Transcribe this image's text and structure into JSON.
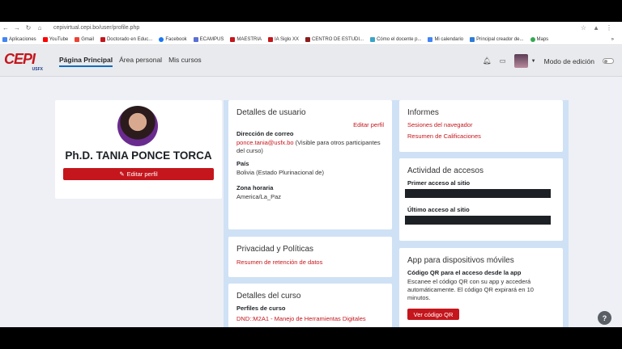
{
  "browser": {
    "url": "cepivirtual.cepi.bo/user/profile.php",
    "bookmarks": [
      {
        "label": "Aplicaciones",
        "color": "#4285f4"
      },
      {
        "label": "YouTube",
        "color": "#ff0000"
      },
      {
        "label": "Gmail",
        "color": "#ea4335"
      },
      {
        "label": "Doctorado en Educ...",
        "color": "#c4161c"
      },
      {
        "label": "Facebook",
        "color": "#1877f2"
      },
      {
        "label": "ECAMPUS",
        "color": "#5b6fd6"
      },
      {
        "label": "MAESTRIA",
        "color": "#c4161c"
      },
      {
        "label": "IA Siglo XX",
        "color": "#c4161c"
      },
      {
        "label": "CENTRO DE ESTUDI...",
        "color": "#8b1c1c"
      },
      {
        "label": "Cómo el docente p...",
        "color": "#3aa3c8"
      },
      {
        "label": "Mi calendario",
        "color": "#4285f4"
      },
      {
        "label": "Principal creador de...",
        "color": "#2d7bd6"
      },
      {
        "label": "Maps",
        "color": "#34a853"
      }
    ],
    "more": "»"
  },
  "header": {
    "logo": "CEPI",
    "logo_sub": "USFX",
    "nav": [
      "Página Principal",
      "Área personal",
      "Mis cursos"
    ],
    "edit_mode": "Modo de edición"
  },
  "profile": {
    "name": "Ph.D. TANIA PONCE TORCA",
    "edit_button": "Editar perfil"
  },
  "user_details": {
    "title": "Detalles de usuario",
    "edit_link": "Editar perfil",
    "email_label": "Dirección de correo",
    "email": "ponce.tania@usfx.bo",
    "email_note": "(Visible para otros participantes del curso)",
    "country_label": "País",
    "country": "Bolivia (Estado Plurinacional de)",
    "timezone_label": "Zona horaria",
    "timezone": "America/La_Paz"
  },
  "privacy": {
    "title": "Privacidad y Políticas",
    "link": "Resumen de retención de datos"
  },
  "course_details": {
    "title": "Detalles del curso",
    "profiles_label": "Perfiles de curso",
    "course_link": "DND::M2A1 - Manejo de Herramientas Digitales"
  },
  "reports": {
    "title": "Informes",
    "links": [
      "Sesiones del navegador",
      "Resumen de Calificaciones"
    ]
  },
  "access": {
    "title": "Actividad de accesos",
    "first_label": "Primer acceso al sitio",
    "last_label": "Último acceso al sitio"
  },
  "mobile": {
    "title": "App para dispositivos móviles",
    "qr_label": "Código QR para el acceso desde la app",
    "description": "Escanee el código QR con su app y accederá automáticamente. El código QR expirará en 10 minutos.",
    "button": "Ver código QR"
  },
  "help": "?"
}
